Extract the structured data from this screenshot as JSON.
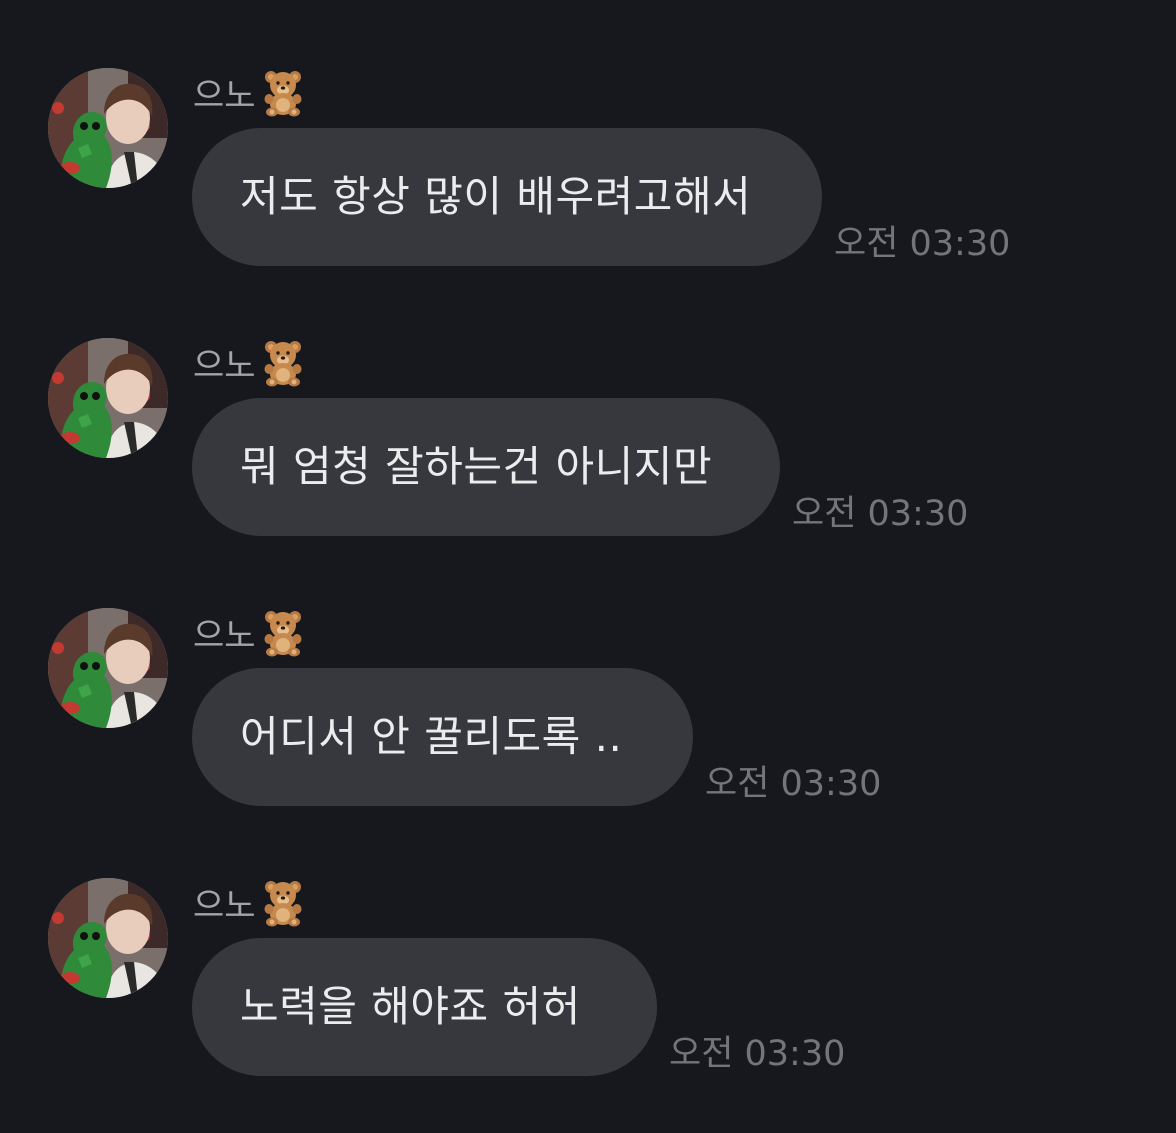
{
  "messages": [
    {
      "sender": "으노",
      "sender_emoji": "bear-icon",
      "text": "저도 항상 많이 배우려고해서",
      "time": "오전 03:30"
    },
    {
      "sender": "으노",
      "sender_emoji": "bear-icon",
      "text": "뭐 엄청 잘하는건 아니지만",
      "time": "오전 03:30"
    },
    {
      "sender": "으노",
      "sender_emoji": "bear-icon",
      "text": "어디서 안 꿀리도록 ..",
      "time": "오전 03:30"
    },
    {
      "sender": "으노",
      "sender_emoji": "bear-icon",
      "text": "노력을 해야죠 허허",
      "time": "오전 03:30"
    }
  ],
  "colors": {
    "background": "#17181d",
    "bubble": "#37383d",
    "bubble_text": "#ececee",
    "sender_text": "#a3a4aa",
    "time_text": "#74757b"
  }
}
